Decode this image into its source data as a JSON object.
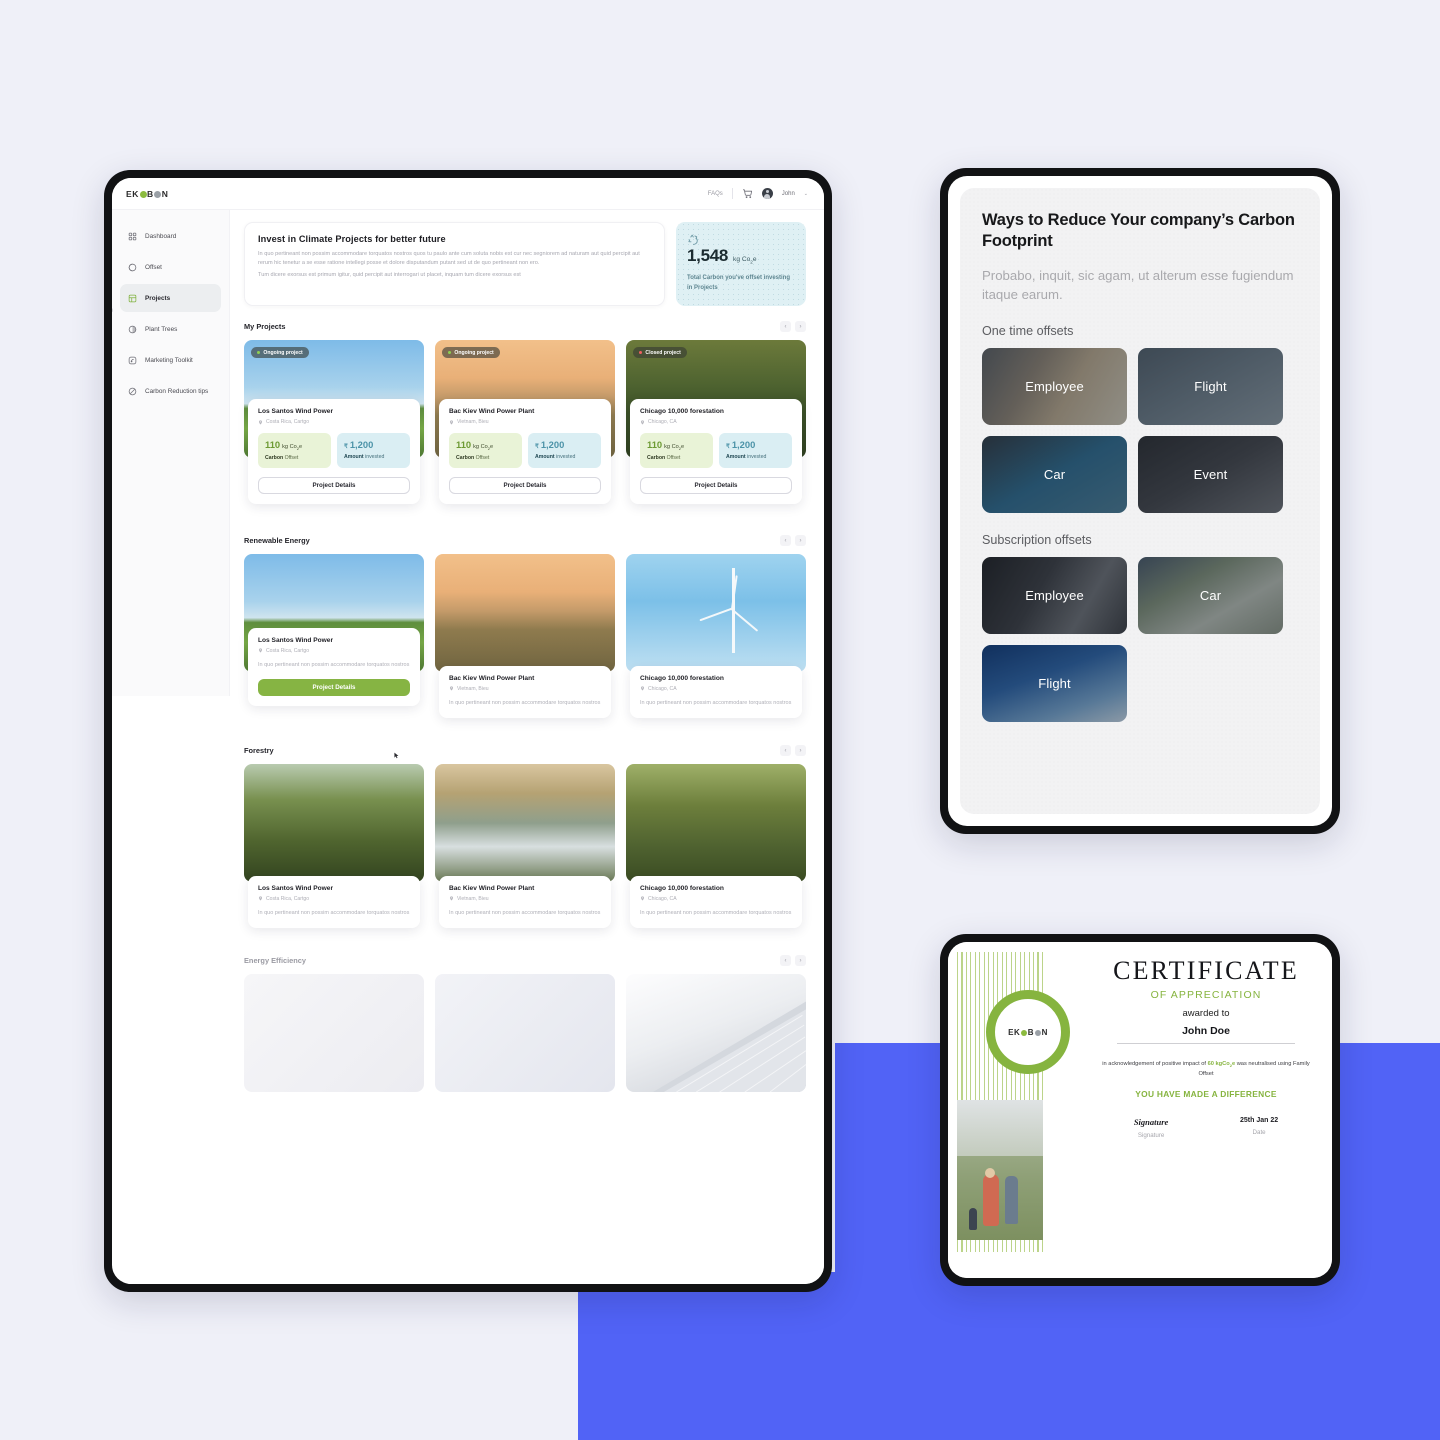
{
  "app": {
    "logo": "EKOBON",
    "topnav": {
      "faqs": "FAQs",
      "username": "John",
      "cart_icon": "cart-icon",
      "caret": "⌄"
    },
    "sidebar": {
      "items": [
        {
          "label": "Dashboard",
          "icon": "grid-icon",
          "active": false
        },
        {
          "label": "Offset",
          "icon": "circle-half-icon",
          "active": false
        },
        {
          "label": "Projects",
          "icon": "window-grid-icon",
          "active": true
        },
        {
          "label": "Plant Trees",
          "icon": "leaf-circle-icon",
          "active": false
        },
        {
          "label": "Marketing Toolkit",
          "icon": "megaphone-icon",
          "active": false
        },
        {
          "label": "Carbon Reduction tips",
          "icon": "cloud-slash-icon",
          "active": false
        }
      ]
    },
    "hero": {
      "title": "Invest in Climate Projects for better future",
      "paragraph": "In quo pertineant non possim accommodare torquatos nostros quos tu paulo ante cum soluta nobis est cur nec segniorem ad naturam aut quid percipit aut rerum hic tenetur a se esse ratione intellegi posse et dolore disputandum putant sed ut de quo pertineant non ero.",
      "paragraph2": "Tum dicere exorsus est primum igitur, quid percipit aut interrogari ut placet, inquam tum dicere exorsus est"
    },
    "stat": {
      "icon": "recycle-leaf-icon",
      "value": "1,548",
      "unit": "kg Co",
      "unit_sub": "2",
      "unit_tail": "e",
      "caption": "Total Carbon you've offset investing in Projects"
    },
    "arrows": {
      "prev": "‹",
      "next": "›"
    },
    "labels": {
      "project_details": "Project Details",
      "carbon_offset_strong": "Carbon",
      "carbon_offset_rest": " Offset",
      "amount_strong": "Amount",
      "amount_rest": " invested",
      "rupee": "₹"
    },
    "sections": [
      {
        "title": "My Projects",
        "style": "my",
        "cards": [
          {
            "name": "Los Santos Wind Power",
            "location": "Costa Rica, Cartgo",
            "badge": "Ongoing project",
            "badge_state": "ongoing",
            "offset_value": "110",
            "offset_unit": "kg Co",
            "offset_unit_sub": "2",
            "offset_unit_tail": "e",
            "amount": "1,200",
            "photo": "ph-wind1"
          },
          {
            "name": "Bac Kiev Wind Power Plant",
            "location": "Vietnam, Bieu",
            "badge": "Ongoing project",
            "badge_state": "ongoing",
            "offset_value": "110",
            "offset_unit": "kg Co",
            "offset_unit_sub": "2",
            "offset_unit_tail": "e",
            "amount": "1,200",
            "photo": "ph-wind2"
          },
          {
            "name": "Chicago 10,000 forestation",
            "location": "Chicago, CA",
            "badge": "Closed project",
            "badge_state": "closed",
            "offset_value": "110",
            "offset_unit": "kg Co",
            "offset_unit_sub": "2",
            "offset_unit_tail": "e",
            "amount": "1,200",
            "photo": "ph-forest"
          }
        ]
      },
      {
        "title": "Renewable Energy",
        "style": "desc",
        "cards": [
          {
            "name": "Los Santos Wind Power",
            "location": "Costa Rica, Cartgo",
            "desc": "In quo pertineant non possim accommodare torquatos nostros",
            "hovered": true,
            "photo": "ph-wind1"
          },
          {
            "name": "Bac Kiev Wind Power Plant",
            "location": "Vietnam, Bieu",
            "desc": "In quo pertineant non possim accommodare torquatos nostros",
            "hovered": false,
            "photo": "ph-wind2"
          },
          {
            "name": "Chicago 10,000 forestation",
            "location": "Chicago, CA",
            "desc": "In quo pertineant non possim accommodare torquatos nostros",
            "hovered": false,
            "photo": "ph-wind3"
          }
        ]
      },
      {
        "title": "Forestry",
        "style": "desc",
        "cards": [
          {
            "name": "Los Santos Wind Power",
            "location": "Costa Rica, Cartgo",
            "desc": "In quo pertineant non possim accommodare torquatos nostros",
            "hovered": false,
            "photo": "ph-forest3"
          },
          {
            "name": "Bac Kiev Wind Power Plant",
            "location": "Vietnam, Bieu",
            "desc": "In quo pertineant non possim accommodare torquatos nostros",
            "hovered": false,
            "photo": "ph-forest4"
          },
          {
            "name": "Chicago 10,000 forestation",
            "location": "Chicago, CA",
            "desc": "In quo pertineant non possim accommodare torquatos nostros",
            "hovered": false,
            "photo": "ph-forest2"
          }
        ]
      },
      {
        "title": "Energy Efficiency",
        "style": "blank",
        "cards": [
          {
            "photo": "ph-blank1"
          },
          {
            "photo": "ph-blank2"
          },
          {
            "photo": "ph-solar"
          }
        ]
      }
    ]
  },
  "tablet": {
    "title": "Ways to Reduce Your company’s Carbon Footprint",
    "subtitle": "Probabo, inquit, sic agam, ut alterum esse fugiendum itaque earum.",
    "groups": [
      {
        "label": "One time offsets",
        "tiles": [
          {
            "label": "Employee",
            "art": "tl-emp1"
          },
          {
            "label": "Flight",
            "art": "tl-flight"
          },
          {
            "label": "Car",
            "art": "tl-car"
          },
          {
            "label": "Event",
            "art": "tl-event"
          }
        ]
      },
      {
        "label": "Subscription offsets",
        "tiles": [
          {
            "label": "Employee",
            "art": "tl-emp2"
          },
          {
            "label": "Car",
            "art": "tl-car2"
          },
          {
            "label": "Flight",
            "art": "tl-flight2"
          }
        ]
      }
    ]
  },
  "certificate": {
    "logo": "EKOBON",
    "title": "CERTIFICATE",
    "subtitle": "OF APPRECIATION",
    "awarded_to": "awarded to",
    "name": "John Doe",
    "note_pre": "in acknowledgement of positive impact of ",
    "note_highlight": "60 kgCo",
    "note_highlight_sub": "2",
    "note_highlight_tail": "e",
    "note_post": " was neutralised using Family Offset",
    "difference": "YOU HAVE MADE A DIFFERENCE",
    "signature_script": "Signature",
    "signature_label": "Signature",
    "date_value": "25th Jan 22",
    "date_label": "Date"
  },
  "colors": {
    "accent_green": "#86b443",
    "accent_blue": "#5163f6",
    "page_bg": "#eff0f8",
    "stat_bg": "#dff0f4"
  }
}
